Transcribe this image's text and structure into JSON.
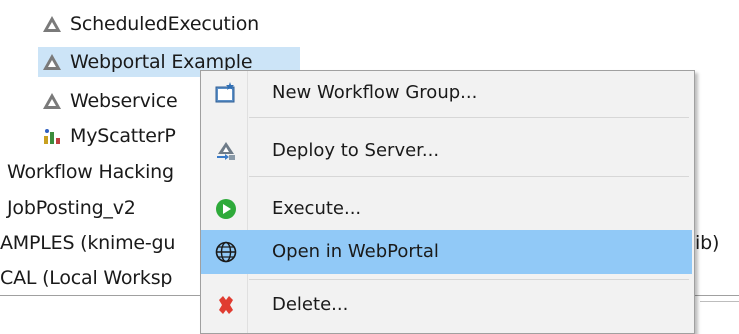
{
  "tree": {
    "items": [
      {
        "label": "ScheduledExecution"
      },
      {
        "label": "Webportal Example"
      },
      {
        "label": "Webservice"
      },
      {
        "label": "MyScatterP"
      },
      {
        "label": "Workflow Hacking"
      },
      {
        "label": "JobPosting_v2"
      },
      {
        "label": "AMPLES (knime-gu"
      },
      {
        "label": "CAL (Local Worksp"
      },
      {
        "label": "ib)"
      }
    ]
  },
  "context_menu": {
    "items": [
      {
        "label": "New Workflow Group...",
        "icon": "new-folder-icon"
      },
      {
        "label": "Deploy to Server...",
        "icon": "deploy-icon"
      },
      {
        "label": "Execute...",
        "icon": "execute-icon"
      },
      {
        "label": "Open in WebPortal",
        "icon": "globe-icon"
      },
      {
        "label": "Delete...",
        "icon": "delete-icon"
      }
    ]
  },
  "colors": {
    "selection": "#cce4f7",
    "menu_highlight": "#91c9f7",
    "execute_green": "#2eaa3a",
    "delete_red": "#e03c31"
  }
}
